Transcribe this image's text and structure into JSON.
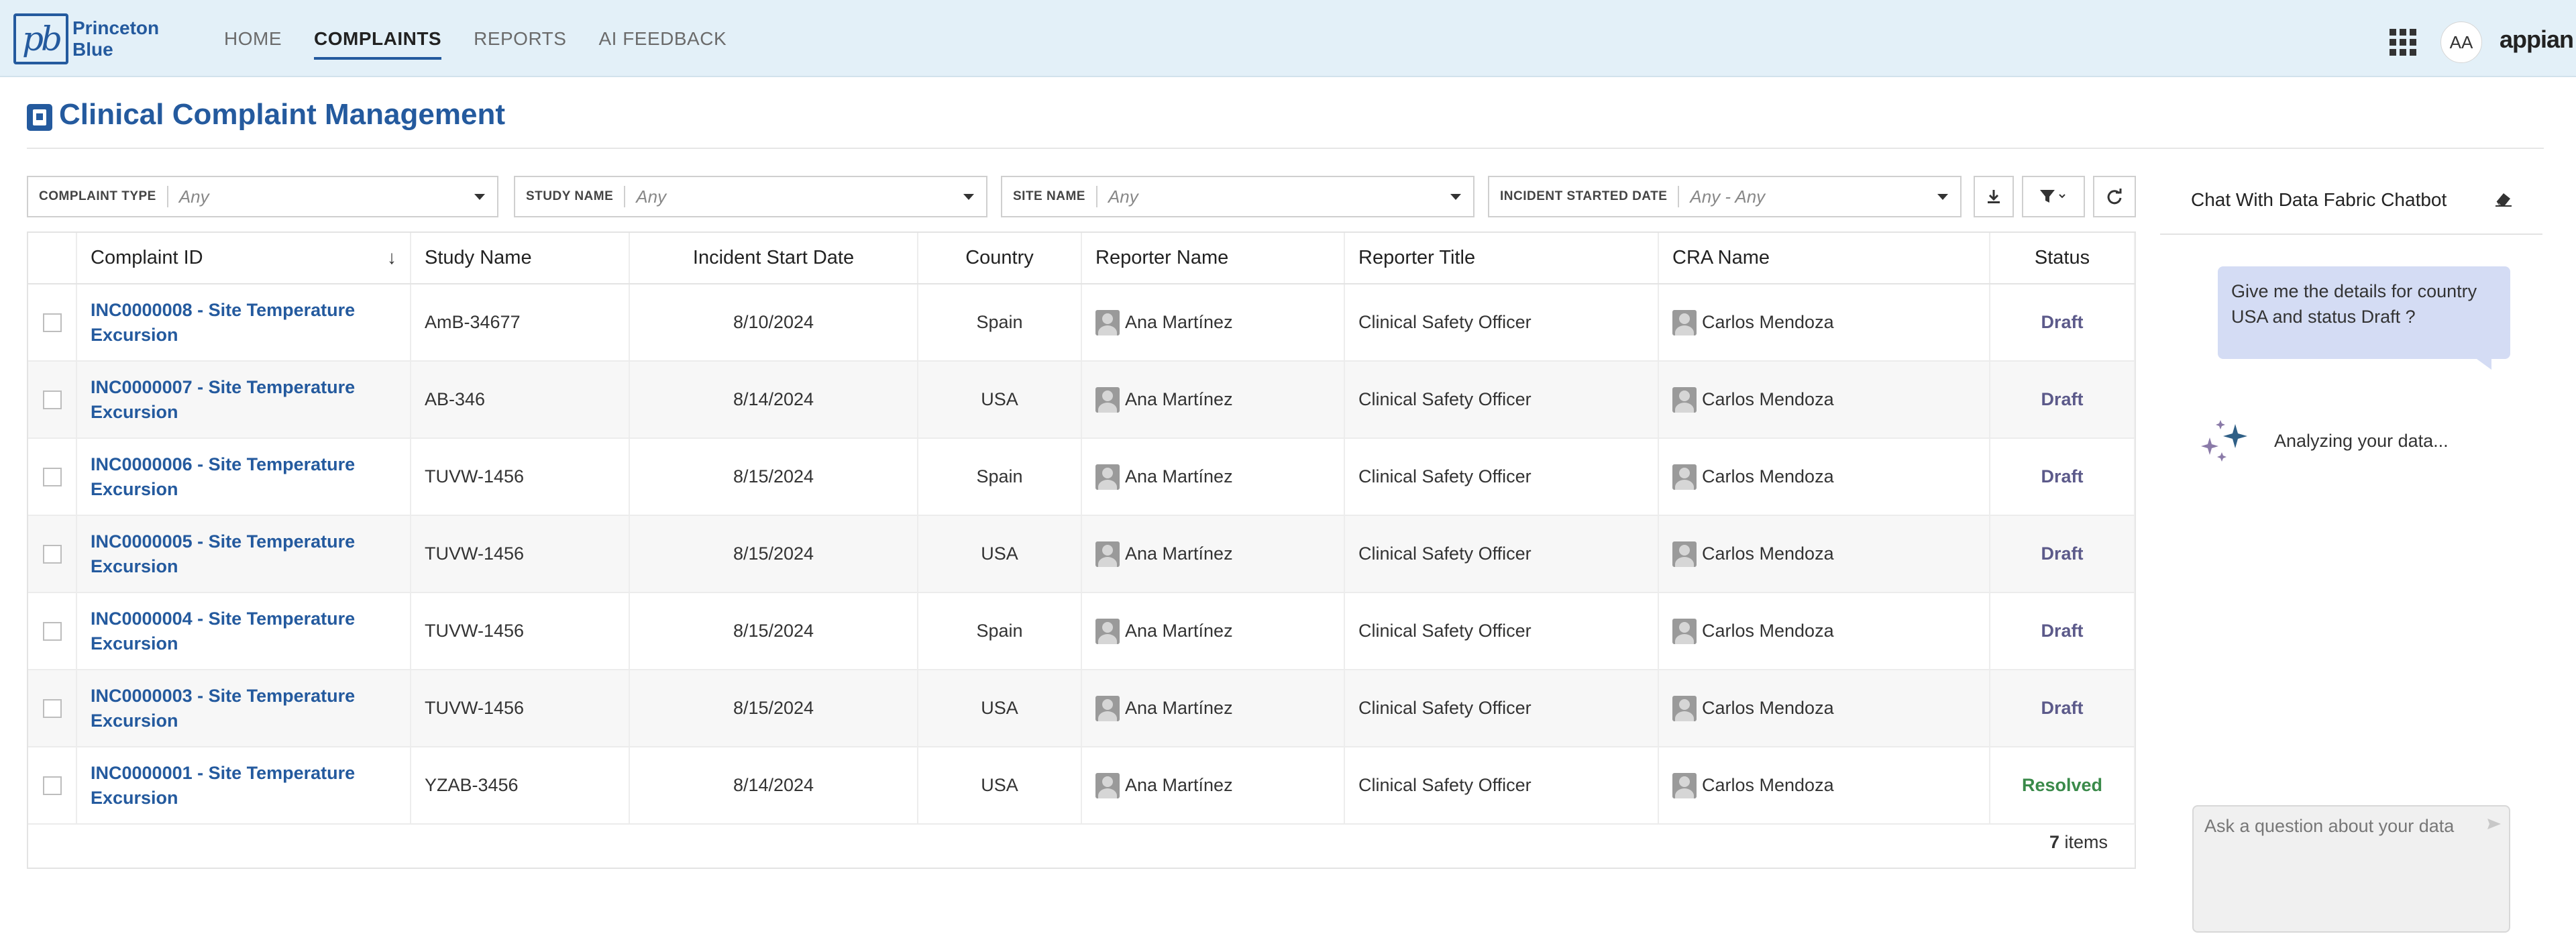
{
  "header": {
    "brand_line1": "Princeton",
    "brand_line2": "Blue",
    "logo_text": "pb",
    "nav": [
      {
        "label": "HOME",
        "active": false
      },
      {
        "label": "COMPLAINTS",
        "active": true
      },
      {
        "label": "REPORTS",
        "active": false
      },
      {
        "label": "AI FEEDBACK",
        "active": false
      }
    ],
    "apps_icon": "grid-icon",
    "avatar_initials": "AA",
    "vendor_logo": "appian"
  },
  "page": {
    "title": "Clinical Complaint Management",
    "title_icon": "complaint-icon"
  },
  "filters": [
    {
      "label": "COMPLAINT TYPE",
      "value": "Any"
    },
    {
      "label": "STUDY NAME",
      "value": "Any"
    },
    {
      "label": "SITE NAME",
      "value": "Any"
    },
    {
      "label": "INCIDENT STARTED DATE",
      "value": "Any - Any"
    }
  ],
  "toolbar": {
    "download_icon": "download-icon",
    "filter_icon": "filter-icon",
    "refresh_icon": "refresh-icon"
  },
  "table": {
    "columns": [
      "Complaint ID",
      "Study Name",
      "Incident Start Date",
      "Country",
      "Reporter Name",
      "Reporter Title",
      "CRA Name",
      "Status"
    ],
    "rows": [
      {
        "id_line1": "INC0000008 - Site Temperature",
        "id_line2": "Excursion",
        "study": "AmB-34677",
        "date": "8/10/2024",
        "country": "Spain",
        "reporter": "Ana Martínez",
        "title": "Clinical Safety Officer",
        "cra": "Carlos Mendoza",
        "status": "Draft"
      },
      {
        "id_line1": "INC0000007 - Site Temperature",
        "id_line2": "Excursion",
        "study": "AB-346",
        "date": "8/14/2024",
        "country": "USA",
        "reporter": "Ana Martínez",
        "title": "Clinical Safety Officer",
        "cra": "Carlos Mendoza",
        "status": "Draft"
      },
      {
        "id_line1": "INC0000006 - Site Temperature",
        "id_line2": "Excursion",
        "study": "TUVW-1456",
        "date": "8/15/2024",
        "country": "Spain",
        "reporter": "Ana Martínez",
        "title": "Clinical Safety Officer",
        "cra": "Carlos Mendoza",
        "status": "Draft"
      },
      {
        "id_line1": "INC0000005 - Site Temperature",
        "id_line2": "Excursion",
        "study": "TUVW-1456",
        "date": "8/15/2024",
        "country": "USA",
        "reporter": "Ana Martínez",
        "title": "Clinical Safety Officer",
        "cra": "Carlos Mendoza",
        "status": "Draft"
      },
      {
        "id_line1": "INC0000004 - Site Temperature",
        "id_line2": "Excursion",
        "study": "TUVW-1456",
        "date": "8/15/2024",
        "country": "Spain",
        "reporter": "Ana Martínez",
        "title": "Clinical Safety Officer",
        "cra": "Carlos Mendoza",
        "status": "Draft"
      },
      {
        "id_line1": "INC0000003 - Site Temperature",
        "id_line2": "Excursion",
        "study": "TUVW-1456",
        "date": "8/15/2024",
        "country": "USA",
        "reporter": "Ana Martínez",
        "title": "Clinical Safety Officer",
        "cra": "Carlos Mendoza",
        "status": "Draft"
      },
      {
        "id_line1": "INC0000001 - Site Temperature",
        "id_line2": "Excursion",
        "study": "YZAB-3456",
        "date": "8/14/2024",
        "country": "USA",
        "reporter": "Ana Martínez",
        "title": "Clinical Safety Officer",
        "cra": "Carlos Mendoza",
        "status": "Resolved"
      }
    ],
    "count": "7",
    "count_suffix": " items"
  },
  "chat": {
    "title": "Chat With Data Fabric Chatbot",
    "user_message": "Give me the details for country USA and status Draft ?",
    "status_text": "Analyzing your data...",
    "input_placeholder": "Ask a question about your data"
  },
  "colors": {
    "brand_blue": "#245a9e",
    "header_bg": "#e3f0f8",
    "draft": "#5c5a8a",
    "resolved": "#3a8a4a",
    "bubble_bg": "#d4dcf4"
  }
}
